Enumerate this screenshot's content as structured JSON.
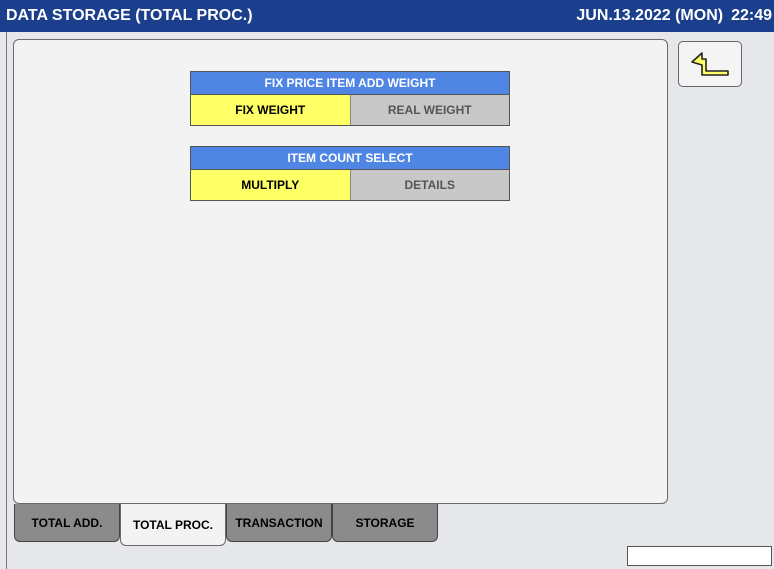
{
  "header": {
    "title": "DATA STORAGE (TOTAL PROC.)",
    "date": "JUN.13.2022 (MON)",
    "time": "22:49"
  },
  "groups": [
    {
      "title": "FIX PRICE ITEM ADD WEIGHT",
      "options": [
        "FIX WEIGHT",
        "REAL WEIGHT"
      ],
      "selected": "FIX WEIGHT"
    },
    {
      "title": "ITEM COUNT SELECT",
      "options": [
        "MULTIPLY",
        "DETAILS"
      ],
      "selected": "MULTIPLY"
    }
  ],
  "back_button": {
    "icon": "return-arrow-icon"
  },
  "tabs": [
    {
      "label": "TOTAL ADD.",
      "active": false
    },
    {
      "label": "TOTAL PROC.",
      "active": true
    },
    {
      "label": "TRANSACTION",
      "active": false
    },
    {
      "label": "STORAGE",
      "active": false
    }
  ],
  "status_box": {
    "text": ""
  },
  "colors": {
    "titlebar": "#1b3f8c",
    "group_header": "#4f86e3",
    "selected": "#ffff66",
    "unselected": "#c8c8c8",
    "tab_inactive": "#8b8b8b"
  }
}
